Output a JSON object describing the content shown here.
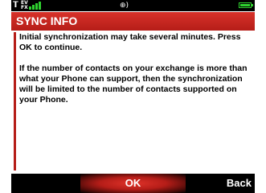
{
  "status_bar": {
    "antenna_icon": "antenna-icon",
    "ev_label": "EV",
    "fx_label": "FX",
    "signal_icon": "signal-strength-icon",
    "audio_icon": "audio-icon",
    "battery_icon": "battery-icon",
    "signal_color": "#2fd12f"
  },
  "title": "SYNC INFO",
  "title_color": "#c8271f",
  "message": {
    "paragraph_1": "Initial synchronization may take several minutes. Press OK to continue.",
    "paragraph_2": "If the number of contacts on your exchange is more than what your Phone can support, then the synchronization will be limited to the number of contacts supported on your Phone."
  },
  "softkeys": {
    "center": "OK",
    "right": "Back"
  }
}
